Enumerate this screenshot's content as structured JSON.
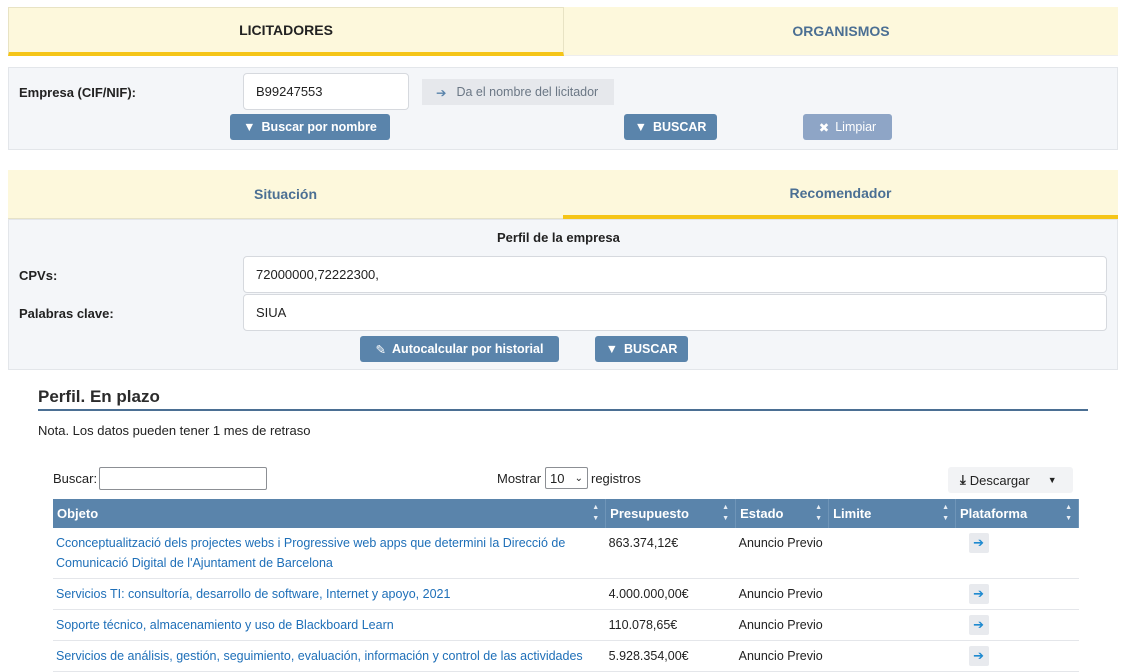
{
  "top_tabs": [
    "LICITADORES",
    "ORGANISMOS"
  ],
  "empresa": {
    "label": "Empresa (CIF/NIF):",
    "value": "B99247553",
    "hint": "Da el nombre del licitador",
    "buscar_nombre": "Buscar por nombre",
    "buscar": "BUSCAR",
    "limpiar": "Limpiar"
  },
  "sub_tabs": [
    "Situación",
    "Recomendador"
  ],
  "perfil": {
    "title": "Perfil de la empresa",
    "cpvs_label": "CPVs:",
    "cpvs_value": "72000000,72222300,",
    "kw_label": "Palabras clave:",
    "kw_value": "SIUA",
    "autocalc": "Autocalcular por historial",
    "buscar": "BUSCAR"
  },
  "section": {
    "title": "Perfil. En plazo",
    "note": "Nota. Los datos pueden tener 1 mes de retraso"
  },
  "table_controls": {
    "search_label": "Buscar:",
    "show_label": "Mostrar",
    "show_value": "10",
    "records_label": "registros",
    "download": "Descargar"
  },
  "table": {
    "headers": [
      "Objeto",
      "Presupuesto",
      "Estado",
      "Limite",
      "Plataforma"
    ],
    "rows": [
      {
        "objeto": "Cconceptualització dels projectes webs i Progressive web apps que determini la Direcció de Comunicació Digital de l'Ajuntament de Barcelona",
        "presupuesto": "863.374,12€",
        "estado": "Anuncio Previo",
        "limite": ""
      },
      {
        "objeto": "Servicios TI: consultoría, desarrollo de software, Internet y apoyo, 2021",
        "presupuesto": "4.000.000,00€",
        "estado": "Anuncio Previo",
        "limite": ""
      },
      {
        "objeto": "Soporte técnico, almacenamiento y uso de Blackboard Learn",
        "presupuesto": "110.078,65€",
        "estado": "Anuncio Previo",
        "limite": ""
      },
      {
        "objeto": "Servicios de análisis, gestión, seguimiento, evaluación, información y control de las actividades",
        "presupuesto": "5.928.354,00€",
        "estado": "Anuncio Previo",
        "limite": ""
      }
    ]
  },
  "colors": {
    "accent_yellow": "#f5c518",
    "button_blue": "#5a84ab",
    "tab_bg": "#fdf8dc",
    "link": "#1e6fb8"
  }
}
